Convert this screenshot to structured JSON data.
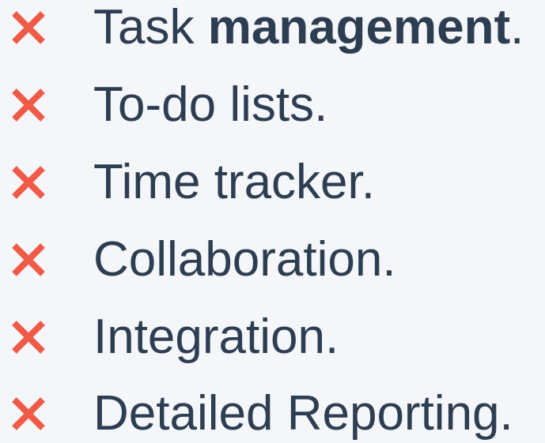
{
  "colors": {
    "background": "#f4f6f9",
    "text": "#2e3e52",
    "cross_icon": "#f05a47"
  },
  "features": [
    {
      "icon": "cross-icon",
      "text": "Task ",
      "bold": "management",
      "suffix": "."
    },
    {
      "icon": "cross-icon",
      "text": "To-do lists."
    },
    {
      "icon": "cross-icon",
      "text": "Time tracker."
    },
    {
      "icon": "cross-icon",
      "text": "Collaboration."
    },
    {
      "icon": "cross-icon",
      "text": "Integration."
    },
    {
      "icon": "cross-icon",
      "text": "Detailed Reporting."
    }
  ]
}
